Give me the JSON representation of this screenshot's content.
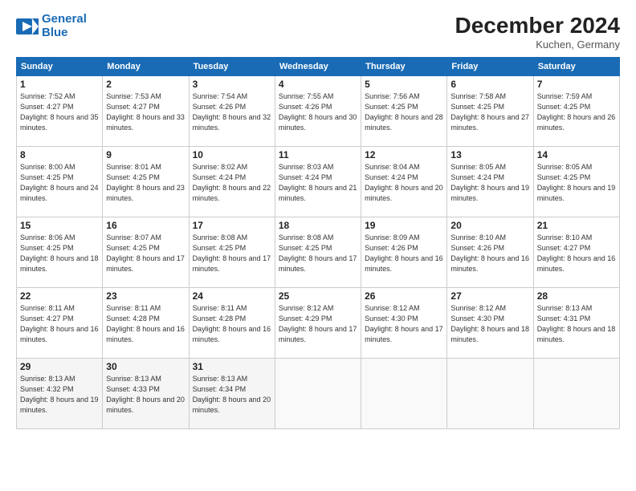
{
  "header": {
    "logo_line1": "General",
    "logo_line2": "Blue",
    "month": "December 2024",
    "location": "Kuchen, Germany"
  },
  "weekdays": [
    "Sunday",
    "Monday",
    "Tuesday",
    "Wednesday",
    "Thursday",
    "Friday",
    "Saturday"
  ],
  "weeks": [
    [
      {
        "day": "1",
        "info": "Sunrise: 7:52 AM\nSunset: 4:27 PM\nDaylight: 8 hours\nand 35 minutes."
      },
      {
        "day": "2",
        "info": "Sunrise: 7:53 AM\nSunset: 4:27 PM\nDaylight: 8 hours\nand 33 minutes."
      },
      {
        "day": "3",
        "info": "Sunrise: 7:54 AM\nSunset: 4:26 PM\nDaylight: 8 hours\nand 32 minutes."
      },
      {
        "day": "4",
        "info": "Sunrise: 7:55 AM\nSunset: 4:26 PM\nDaylight: 8 hours\nand 30 minutes."
      },
      {
        "day": "5",
        "info": "Sunrise: 7:56 AM\nSunset: 4:25 PM\nDaylight: 8 hours\nand 28 minutes."
      },
      {
        "day": "6",
        "info": "Sunrise: 7:58 AM\nSunset: 4:25 PM\nDaylight: 8 hours\nand 27 minutes."
      },
      {
        "day": "7",
        "info": "Sunrise: 7:59 AM\nSunset: 4:25 PM\nDaylight: 8 hours\nand 26 minutes."
      }
    ],
    [
      {
        "day": "8",
        "info": "Sunrise: 8:00 AM\nSunset: 4:25 PM\nDaylight: 8 hours\nand 24 minutes."
      },
      {
        "day": "9",
        "info": "Sunrise: 8:01 AM\nSunset: 4:25 PM\nDaylight: 8 hours\nand 23 minutes."
      },
      {
        "day": "10",
        "info": "Sunrise: 8:02 AM\nSunset: 4:24 PM\nDaylight: 8 hours\nand 22 minutes."
      },
      {
        "day": "11",
        "info": "Sunrise: 8:03 AM\nSunset: 4:24 PM\nDaylight: 8 hours\nand 21 minutes."
      },
      {
        "day": "12",
        "info": "Sunrise: 8:04 AM\nSunset: 4:24 PM\nDaylight: 8 hours\nand 20 minutes."
      },
      {
        "day": "13",
        "info": "Sunrise: 8:05 AM\nSunset: 4:24 PM\nDaylight: 8 hours\nand 19 minutes."
      },
      {
        "day": "14",
        "info": "Sunrise: 8:05 AM\nSunset: 4:25 PM\nDaylight: 8 hours\nand 19 minutes."
      }
    ],
    [
      {
        "day": "15",
        "info": "Sunrise: 8:06 AM\nSunset: 4:25 PM\nDaylight: 8 hours\nand 18 minutes."
      },
      {
        "day": "16",
        "info": "Sunrise: 8:07 AM\nSunset: 4:25 PM\nDaylight: 8 hours\nand 17 minutes."
      },
      {
        "day": "17",
        "info": "Sunrise: 8:08 AM\nSunset: 4:25 PM\nDaylight: 8 hours\nand 17 minutes."
      },
      {
        "day": "18",
        "info": "Sunrise: 8:08 AM\nSunset: 4:25 PM\nDaylight: 8 hours\nand 17 minutes."
      },
      {
        "day": "19",
        "info": "Sunrise: 8:09 AM\nSunset: 4:26 PM\nDaylight: 8 hours\nand 16 minutes."
      },
      {
        "day": "20",
        "info": "Sunrise: 8:10 AM\nSunset: 4:26 PM\nDaylight: 8 hours\nand 16 minutes."
      },
      {
        "day": "21",
        "info": "Sunrise: 8:10 AM\nSunset: 4:27 PM\nDaylight: 8 hours\nand 16 minutes."
      }
    ],
    [
      {
        "day": "22",
        "info": "Sunrise: 8:11 AM\nSunset: 4:27 PM\nDaylight: 8 hours\nand 16 minutes."
      },
      {
        "day": "23",
        "info": "Sunrise: 8:11 AM\nSunset: 4:28 PM\nDaylight: 8 hours\nand 16 minutes."
      },
      {
        "day": "24",
        "info": "Sunrise: 8:11 AM\nSunset: 4:28 PM\nDaylight: 8 hours\nand 16 minutes."
      },
      {
        "day": "25",
        "info": "Sunrise: 8:12 AM\nSunset: 4:29 PM\nDaylight: 8 hours\nand 17 minutes."
      },
      {
        "day": "26",
        "info": "Sunrise: 8:12 AM\nSunset: 4:30 PM\nDaylight: 8 hours\nand 17 minutes."
      },
      {
        "day": "27",
        "info": "Sunrise: 8:12 AM\nSunset: 4:30 PM\nDaylight: 8 hours\nand 18 minutes."
      },
      {
        "day": "28",
        "info": "Sunrise: 8:13 AM\nSunset: 4:31 PM\nDaylight: 8 hours\nand 18 minutes."
      }
    ],
    [
      {
        "day": "29",
        "info": "Sunrise: 8:13 AM\nSunset: 4:32 PM\nDaylight: 8 hours\nand 19 minutes."
      },
      {
        "day": "30",
        "info": "Sunrise: 8:13 AM\nSunset: 4:33 PM\nDaylight: 8 hours\nand 20 minutes."
      },
      {
        "day": "31",
        "info": "Sunrise: 8:13 AM\nSunset: 4:34 PM\nDaylight: 8 hours\nand 20 minutes."
      },
      null,
      null,
      null,
      null
    ]
  ]
}
